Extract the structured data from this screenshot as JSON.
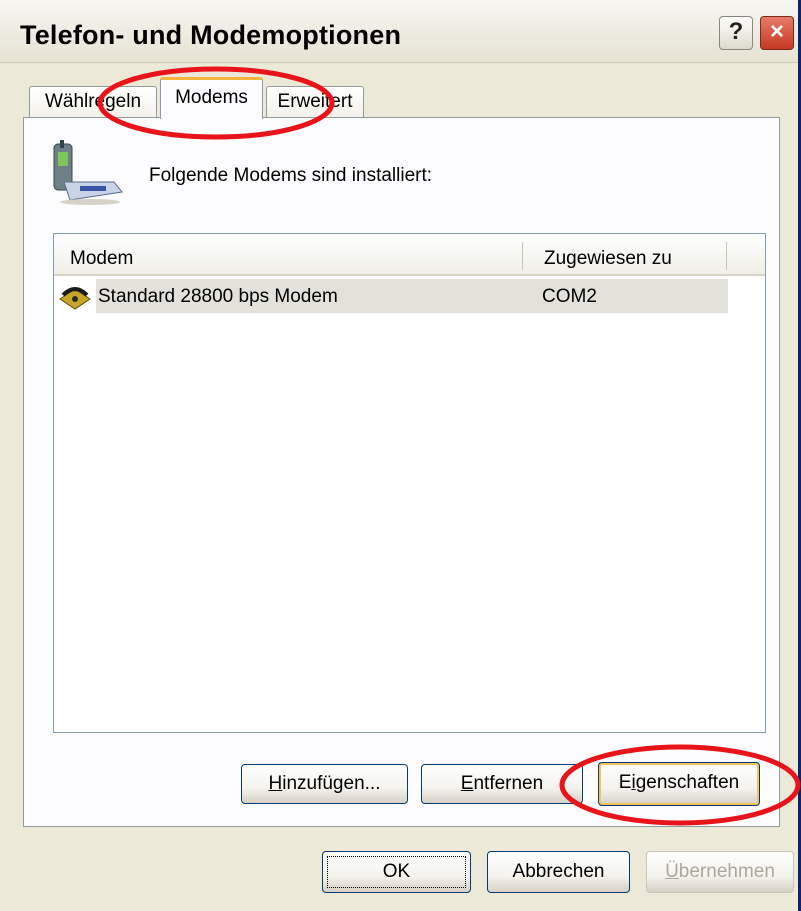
{
  "window": {
    "title": "Telefon- und Modemoptionen"
  },
  "titlebar_buttons": {
    "help_label": "?",
    "close_label": "×"
  },
  "tabs": [
    {
      "label": "Wählregeln",
      "active": false
    },
    {
      "label": "Modems",
      "active": true
    },
    {
      "label": "Erweitert",
      "active": false
    }
  ],
  "panel": {
    "installed_text": "Folgende Modems sind installiert:"
  },
  "list": {
    "columns": [
      "Modem",
      "Zugewiesen zu"
    ],
    "rows": [
      {
        "modem": "Standard 28800 bps Modem",
        "port": "COM2"
      }
    ]
  },
  "buttons": {
    "add": {
      "mnemonic": "H",
      "rest": "inzufügen..."
    },
    "remove": {
      "mnemonic": "E",
      "rest": "ntfernen"
    },
    "properties": {
      "lead": "E",
      "mnemonic": "i",
      "rest": "genschaften"
    },
    "ok": "OK",
    "cancel": "Abbrechen",
    "apply": {
      "mnemonic": "Ü",
      "rest": "bernehmen",
      "disabled": true
    }
  },
  "colors": {
    "annotation": "#e8141a",
    "focus_orange": "#f7b33e"
  }
}
